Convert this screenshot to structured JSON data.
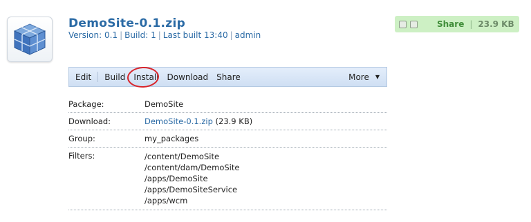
{
  "package": {
    "title": "DemoSite-0.1.zip",
    "meta": {
      "version": "Version: 0.1",
      "build": "Build: 1",
      "last_built": "Last built 13:40",
      "user": "admin"
    }
  },
  "badge": {
    "label": "Share",
    "size": "23.9 KB"
  },
  "toolbar": {
    "edit": "Edit",
    "build": "Build",
    "install": "Install",
    "download": "Download",
    "share": "Share",
    "more": "More"
  },
  "details": {
    "package_label": "Package:",
    "package_value": "DemoSite",
    "download_label": "Download:",
    "download_link": "DemoSite-0.1.zip",
    "download_size": "(23.9 KB)",
    "group_label": "Group:",
    "group_value": "my_packages",
    "filters_label": "Filters:",
    "filters": [
      "/content/DemoSite",
      "/content/dam/DemoSite",
      "/apps/DemoSite",
      "/apps/DemoSiteService",
      "/apps/wcm"
    ]
  },
  "colors": {
    "link": "#2a6aa5",
    "badge_bg": "#cdf0c4",
    "annotation": "#d9242a"
  }
}
